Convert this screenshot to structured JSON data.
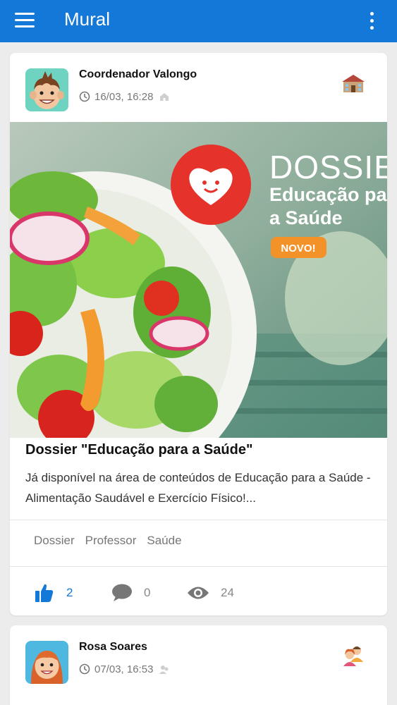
{
  "appbar": {
    "title": "Mural",
    "menu_icon": "menu-icon",
    "more_icon": "more-vertical-icon",
    "color": "#1478d8"
  },
  "posts": [
    {
      "author": "Coordenador Valongo",
      "date": "16/03, 16:28",
      "audience_icon": "school-building-icon",
      "title": "Dossier \"Educação para a Saúde\"",
      "body": "Já disponível na área de conteúdos de Educação para a Saúde - Alimentação Saudável e Exercício Físico!...",
      "image": {
        "heading": "DOSSIE",
        "subtitle_line1": "Educação pa",
        "subtitle_line2": "a Saúde",
        "badge": "NOVO!"
      },
      "tags": [
        "Dossier",
        "Professor",
        "Saúde"
      ],
      "likes": "2",
      "comments": "0",
      "views": "24"
    },
    {
      "author": "Rosa Soares",
      "date": "07/03, 16:53",
      "audience_icon": "parents-icon"
    }
  ]
}
